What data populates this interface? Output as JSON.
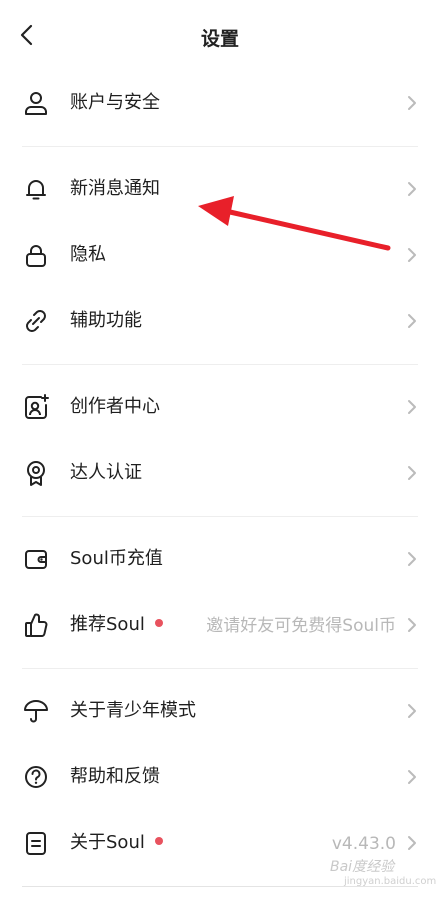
{
  "header": {
    "title": "设置"
  },
  "rows": [
    {
      "label": "账户与安全",
      "icon": "user-icon"
    },
    {
      "label": "新消息通知",
      "icon": "bell-icon"
    },
    {
      "label": "隐私",
      "icon": "lock-icon"
    },
    {
      "label": "辅助功能",
      "icon": "link-icon"
    },
    {
      "label": "创作者中心",
      "icon": "creator-icon"
    },
    {
      "label": "达人认证",
      "icon": "badge-icon"
    },
    {
      "label": "Soul币充值",
      "icon": "wallet-icon"
    },
    {
      "label": "推荐Soul",
      "icon": "thumbs-up-icon",
      "subtitle": "邀请好友可免费得Soul币",
      "dot": true
    },
    {
      "label": "关于青少年模式",
      "icon": "umbrella-icon"
    },
    {
      "label": "帮助和反馈",
      "icon": "help-icon"
    },
    {
      "label": "关于Soul",
      "icon": "about-icon",
      "subtitle": "v4.43.0",
      "dot": true
    }
  ],
  "watermark": {
    "text": "Bai度经验",
    "sub": "jingyan.baidu.com"
  },
  "colors": {
    "dot": "#e8525e",
    "annotation_arrow": "#e8202a"
  }
}
